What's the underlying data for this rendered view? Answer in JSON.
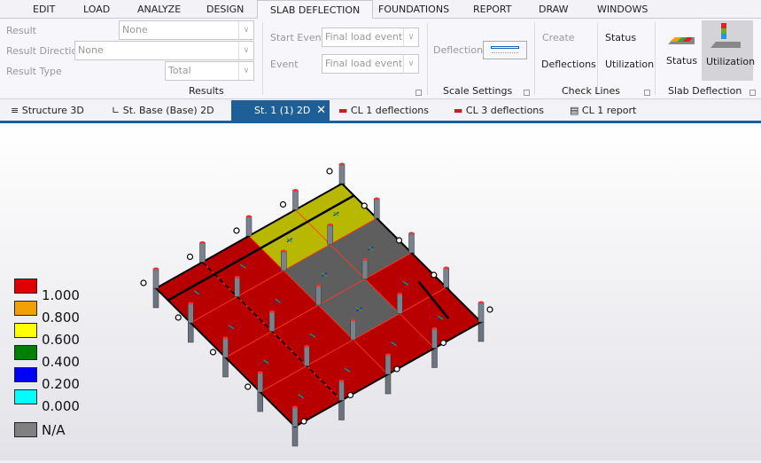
{
  "menu": [
    "EDIT",
    "LOAD",
    "ANALYZE",
    "DESIGN",
    "SLAB DEFLECTION",
    "FOUNDATIONS",
    "REPORT",
    "DRAW",
    "WINDOWS"
  ],
  "results": {
    "result_label": "Result",
    "result_value": "None",
    "direction_label": "Result Direction",
    "direction_value": "None",
    "type_label": "Result Type",
    "type_value": "Total",
    "group": "Results"
  },
  "events": {
    "start_label": "Start Event",
    "start_value": "Final load event",
    "event_label": "Event",
    "event_value": "Final load event"
  },
  "scale": {
    "deflections": "Deflections",
    "group": "Scale Settings"
  },
  "check_lines": {
    "create": "Create",
    "deflections": "Deflections",
    "status": "Status",
    "utilization": "Utilization",
    "group": "Check Lines"
  },
  "slab_deflection": {
    "status": "Status",
    "utilization": "Utilization",
    "group": "Slab Deflection"
  },
  "doc_tabs": [
    "Structure 3D",
    "St. Base (Base) 2D",
    "St. 1 (1) 2D",
    "CL 1 deflections",
    "CL 3 deflections",
    "CL 1 report"
  ],
  "legend": [
    {
      "label": "1.000",
      "color": "#e00000"
    },
    {
      "label": "0.800",
      "color": "#f0a000"
    },
    {
      "label": "0.600",
      "color": "#ffff00"
    },
    {
      "label": "0.400",
      "color": "#008000"
    },
    {
      "label": "0.200",
      "color": "#0000ff"
    },
    {
      "label": "0.000",
      "color": "#00ffff"
    },
    {
      "label": "N/A",
      "color": "#808080"
    }
  ],
  "slab_cells": [
    [
      "red",
      "red",
      "yellow",
      "yellow"
    ],
    [
      "red",
      "red",
      "gray",
      "gray"
    ],
    [
      "red",
      "red",
      "gray",
      "red"
    ],
    [
      "red",
      "red",
      "red",
      "red"
    ]
  ],
  "colors": {
    "red": "#b80000",
    "yellow": "#b8b800",
    "gray": "#5e5e5e",
    "accent": "#1f5f97"
  }
}
